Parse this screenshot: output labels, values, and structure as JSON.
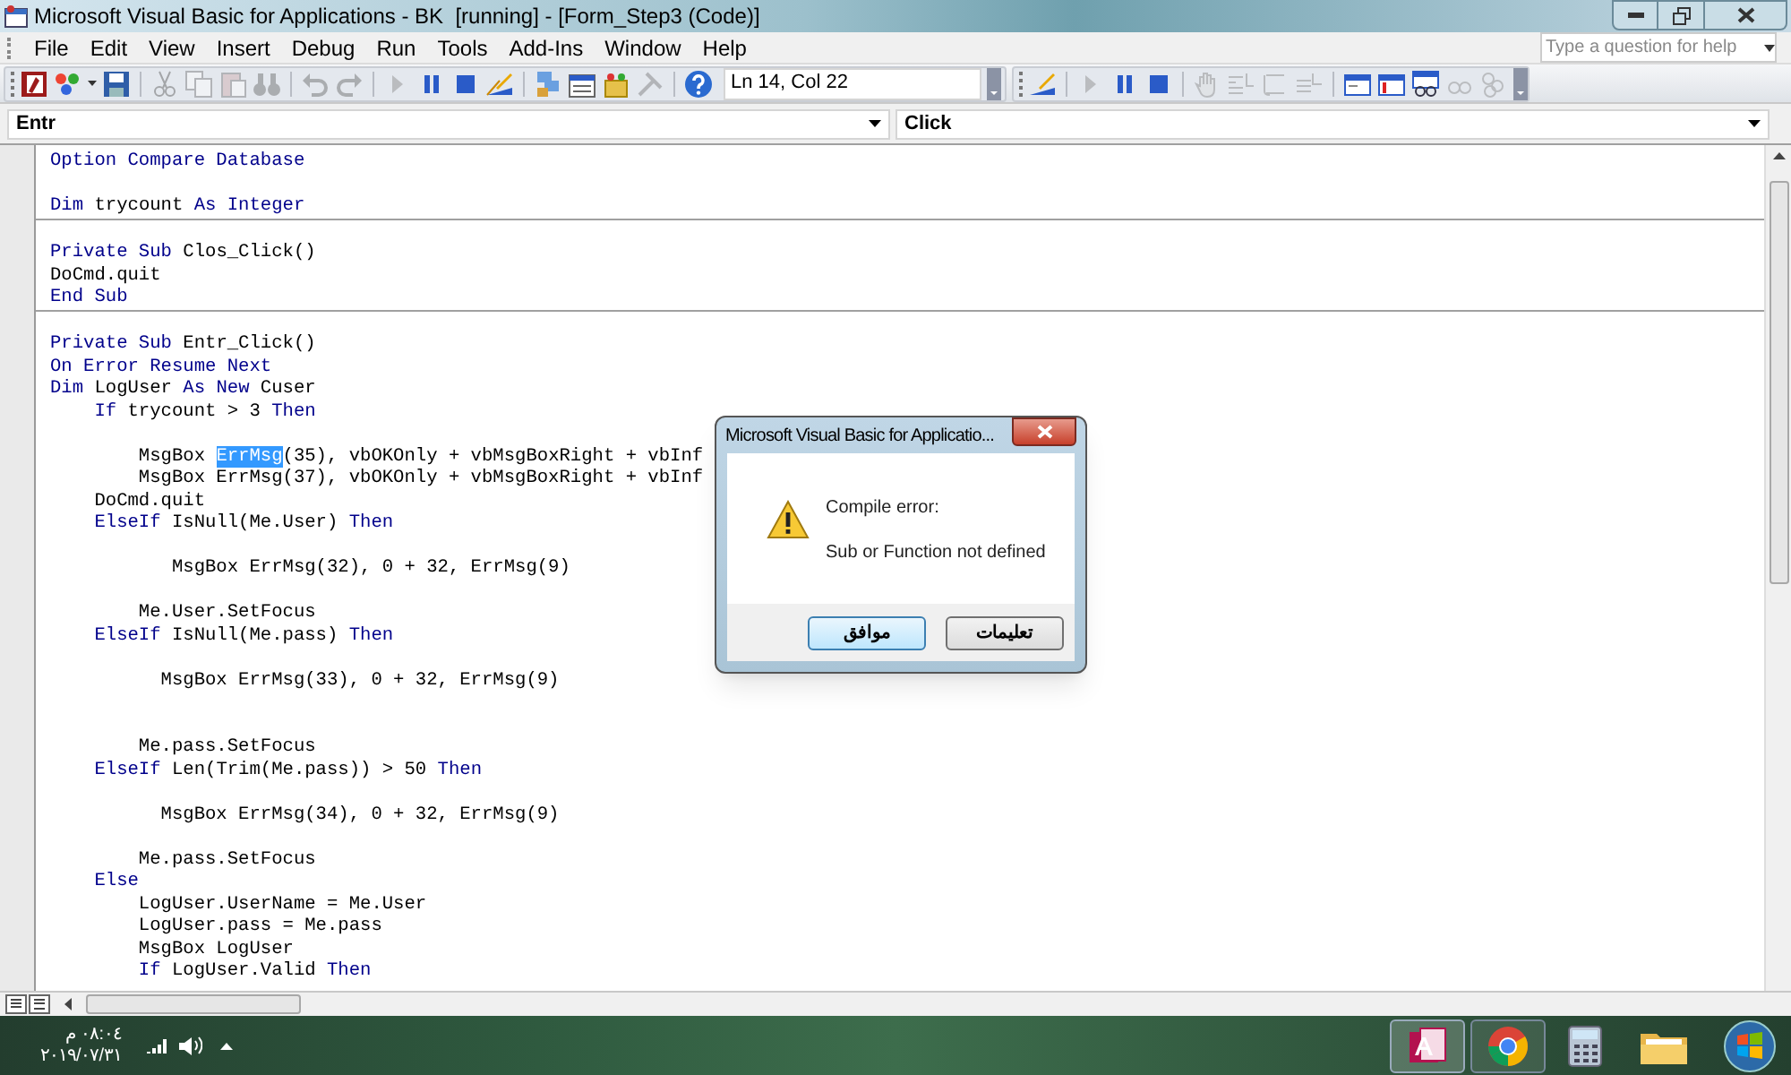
{
  "window": {
    "title": "Microsoft Visual Basic for Applications - BK  [running] - [Form_Step3 (Code)]"
  },
  "menu": [
    "File",
    "Edit",
    "View",
    "Insert",
    "Debug",
    "Run",
    "Tools",
    "Add-Ins",
    "Window",
    "Help"
  ],
  "help_box": {
    "placeholder": "Type a question for help"
  },
  "toolbar": {
    "position": "Ln 14, Col 22"
  },
  "object_combo": {
    "value": "Entr"
  },
  "procedure_combo": {
    "value": "Click"
  },
  "code_blocks": [
    [
      {
        "kind": "code",
        "segments": [
          {
            "kind": "keyword",
            "text": "Option Compare Database"
          }
        ]
      },
      {
        "kind": "blank"
      },
      {
        "kind": "code",
        "segments": [
          {
            "kind": "keyword",
            "text": "Dim"
          },
          {
            "kind": "plain",
            "text": " trycount "
          },
          {
            "kind": "keyword",
            "text": "As Integer"
          }
        ]
      }
    ],
    [
      {
        "kind": "blank"
      },
      {
        "kind": "code",
        "segments": [
          {
            "kind": "keyword",
            "text": "Private Sub"
          },
          {
            "kind": "plain",
            "text": " Clos_Click()"
          }
        ]
      },
      {
        "kind": "code",
        "segments": [
          {
            "kind": "plain",
            "text": "DoCmd.quit"
          }
        ]
      },
      {
        "kind": "code",
        "segments": [
          {
            "kind": "keyword",
            "text": "End Sub"
          }
        ]
      }
    ],
    [
      {
        "kind": "blank"
      },
      {
        "kind": "code",
        "segments": [
          {
            "kind": "keyword",
            "text": "Private Sub"
          },
          {
            "kind": "plain",
            "text": " Entr_Click()"
          }
        ]
      },
      {
        "kind": "code",
        "segments": [
          {
            "kind": "keyword",
            "text": "On Error Resume Next"
          }
        ]
      },
      {
        "kind": "code",
        "segments": [
          {
            "kind": "keyword",
            "text": "Dim"
          },
          {
            "kind": "plain",
            "text": " LogUser "
          },
          {
            "kind": "keyword",
            "text": "As New"
          },
          {
            "kind": "plain",
            "text": " Cuser"
          }
        ]
      },
      {
        "kind": "code",
        "segments": [
          {
            "kind": "keyword",
            "text": "    If"
          },
          {
            "kind": "plain",
            "text": " trycount > 3 "
          },
          {
            "kind": "keyword",
            "text": "Then"
          }
        ]
      },
      {
        "kind": "blank"
      },
      {
        "kind": "code",
        "segments": [
          {
            "kind": "plain",
            "text": "        MsgBox "
          },
          {
            "kind": "selected",
            "text": "ErrMsg"
          },
          {
            "kind": "plain",
            "text": "(35), vbOKOnly + vbMsgBoxRight + vbInf"
          }
        ]
      },
      {
        "kind": "code",
        "segments": [
          {
            "kind": "plain",
            "text": "        MsgBox ErrMsg(37), vbOKOnly + vbMsgBoxRight + vbInf"
          }
        ]
      },
      {
        "kind": "code",
        "segments": [
          {
            "kind": "plain",
            "text": "    DoCmd.quit"
          }
        ]
      },
      {
        "kind": "code",
        "segments": [
          {
            "kind": "keyword",
            "text": "    ElseIf"
          },
          {
            "kind": "plain",
            "text": " IsNull(Me.User) "
          },
          {
            "kind": "keyword",
            "text": "Then"
          }
        ]
      },
      {
        "kind": "blank"
      },
      {
        "kind": "code",
        "segments": [
          {
            "kind": "plain",
            "text": "           MsgBox ErrMsg(32), 0 + 32, ErrMsg(9)"
          }
        ]
      },
      {
        "kind": "blank"
      },
      {
        "kind": "code",
        "segments": [
          {
            "kind": "plain",
            "text": "        Me.User.SetFocus"
          }
        ]
      },
      {
        "kind": "code",
        "segments": [
          {
            "kind": "keyword",
            "text": "    ElseIf"
          },
          {
            "kind": "plain",
            "text": " IsNull(Me.pass) "
          },
          {
            "kind": "keyword",
            "text": "Then"
          }
        ]
      },
      {
        "kind": "blank"
      },
      {
        "kind": "code",
        "segments": [
          {
            "kind": "plain",
            "text": "          MsgBox ErrMsg(33), 0 + 32, ErrMsg(9)"
          }
        ]
      },
      {
        "kind": "blank"
      },
      {
        "kind": "blank"
      },
      {
        "kind": "code",
        "segments": [
          {
            "kind": "plain",
            "text": "        Me.pass.SetFocus"
          }
        ]
      },
      {
        "kind": "code",
        "segments": [
          {
            "kind": "keyword",
            "text": "    ElseIf"
          },
          {
            "kind": "plain",
            "text": " Len(Trim(Me.pass)) > 50 "
          },
          {
            "kind": "keyword",
            "text": "Then"
          }
        ]
      },
      {
        "kind": "blank"
      },
      {
        "kind": "code",
        "segments": [
          {
            "kind": "plain",
            "text": "          MsgBox ErrMsg(34), 0 + 32, ErrMsg(9)"
          }
        ]
      },
      {
        "kind": "blank"
      },
      {
        "kind": "code",
        "segments": [
          {
            "kind": "plain",
            "text": "        Me.pass.SetFocus"
          }
        ]
      },
      {
        "kind": "code",
        "segments": [
          {
            "kind": "keyword",
            "text": "    Else"
          }
        ]
      },
      {
        "kind": "code",
        "segments": [
          {
            "kind": "plain",
            "text": "        LogUser.UserName = Me.User"
          }
        ]
      },
      {
        "kind": "code",
        "segments": [
          {
            "kind": "plain",
            "text": "        LogUser.pass = Me.pass"
          }
        ]
      },
      {
        "kind": "code",
        "segments": [
          {
            "kind": "plain",
            "text": "        MsgBox LogUser"
          }
        ]
      },
      {
        "kind": "code",
        "segments": [
          {
            "kind": "keyword",
            "text": "        If"
          },
          {
            "kind": "plain",
            "text": " LogUser.Valid "
          },
          {
            "kind": "keyword",
            "text": "Then"
          }
        ]
      }
    ]
  ],
  "dialog": {
    "title": "Microsoft Visual Basic for Applicatio...",
    "heading": "Compile error:",
    "message": "Sub or Function not defined",
    "buttons": [
      {
        "label": "تعليمات",
        "default": false
      },
      {
        "label": "موافق",
        "default": true
      }
    ]
  },
  "taskbar": {
    "time": "٠٨:٠٤ م",
    "date": "٢٠١٩/٠٧/٣١"
  }
}
